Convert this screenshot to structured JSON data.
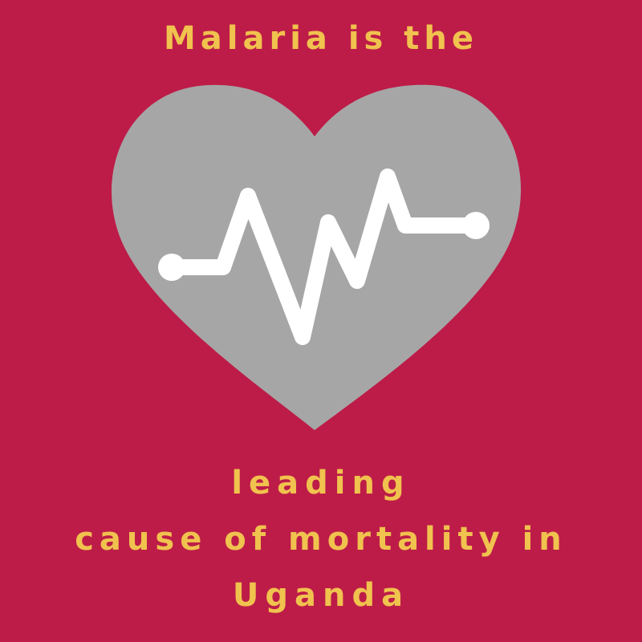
{
  "poster": {
    "line_top": "Malaria is the",
    "line_leading": "leading",
    "line_cause": "cause of mortality in",
    "line_uganda": "Uganda"
  },
  "colors": {
    "background": "#BD1C48",
    "text": "#F0C24E",
    "heart": "#A6A6A6",
    "pulse": "#FFFFFF"
  },
  "icons": {
    "heart": "heart-icon",
    "pulse": "heartbeat-pulse-icon"
  }
}
